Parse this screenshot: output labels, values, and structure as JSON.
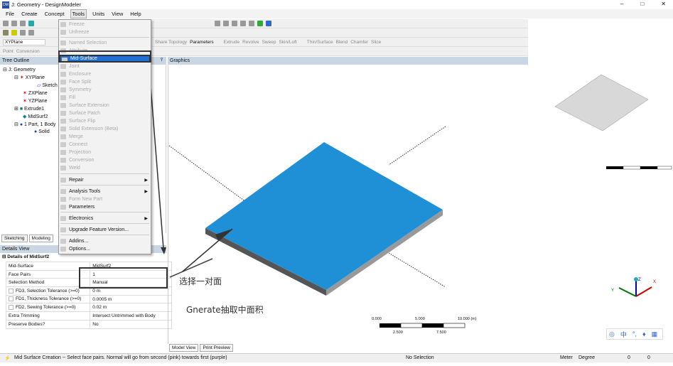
{
  "window": {
    "title": "J: Geometry - DesignModeler",
    "minimize": "–",
    "maximize": "□",
    "close": "✕"
  },
  "menubar": [
    "File",
    "Create",
    "Concept",
    "Tools",
    "Units",
    "View",
    "Help"
  ],
  "toolbar": {
    "plane_select": "XYPlane",
    "point": "Point",
    "conversion": "Conversion",
    "share_topology": "Share Topology",
    "parameters": "Parameters",
    "extrude": "Extrude",
    "revolve": "Revolve",
    "sweep": "Sweep",
    "skin_loft": "Skin/Loft",
    "thin_surface": "Thin/Surface",
    "blend": "Blend",
    "chamfer": "Chamfer",
    "slice": "Slice"
  },
  "tools_menu": [
    {
      "label": "Freeze",
      "enabled": false
    },
    {
      "label": "Unfreeze",
      "enabled": false
    },
    {
      "label": "Named Selection",
      "enabled": false
    },
    {
      "label": "Attribute",
      "enabled": false
    },
    {
      "label": "Mid-Surface",
      "enabled": true,
      "highlighted": true
    },
    {
      "label": "Joint",
      "enabled": false
    },
    {
      "label": "Enclosure",
      "enabled": false
    },
    {
      "label": "Face Split",
      "enabled": false
    },
    {
      "label": "Symmetry",
      "enabled": false
    },
    {
      "label": "Fill",
      "enabled": false
    },
    {
      "label": "Surface Extension",
      "enabled": false
    },
    {
      "label": "Surface Patch",
      "enabled": false
    },
    {
      "label": "Surface Flip",
      "enabled": false
    },
    {
      "label": "Solid Extension (Beta)",
      "enabled": false
    },
    {
      "label": "Merge",
      "enabled": false
    },
    {
      "label": "Connect",
      "enabled": false
    },
    {
      "label": "Projection",
      "enabled": false
    },
    {
      "label": "Conversion",
      "enabled": false
    },
    {
      "label": "Weld",
      "enabled": false
    },
    {
      "label": "Repair",
      "enabled": true,
      "submenu": true
    },
    {
      "label": "Analysis Tools",
      "enabled": true,
      "submenu": true
    },
    {
      "label": "Form New Part",
      "enabled": false
    },
    {
      "label": "Parameters",
      "enabled": true
    },
    {
      "label": "Electronics",
      "enabled": true,
      "submenu": true
    },
    {
      "label": "Upgrade Feature Version...",
      "enabled": true
    },
    {
      "label": "Addins...",
      "enabled": true
    },
    {
      "label": "Options...",
      "enabled": true
    }
  ],
  "tree": {
    "header": "Tree Outline",
    "items": [
      "J: Geometry",
      "XYPlane",
      "Sketch",
      "ZXPlane",
      "YZPlane",
      "Extrude1",
      "MidSurf2",
      "1 Part, 1 Body",
      "Solid"
    ]
  },
  "mode_tabs": [
    "Sketching",
    "Modeling"
  ],
  "details": {
    "header": "Details View",
    "title": "Details of MidSurf2",
    "rows": [
      [
        "Mid-Surface",
        "MidSurf2"
      ],
      [
        "Face Pairs",
        "1"
      ],
      [
        "Selection Method",
        "Manual"
      ],
      [
        "FD3, Selection Tolerance (>=0)",
        "0 m"
      ],
      [
        "FD1, Thickness Tolerance (>=0)",
        "0.0005 m"
      ],
      [
        "FD2, Sewing Tolerance (>=0)",
        "0.02 m"
      ],
      [
        "Extra Trimming",
        "Intersect Untrimmed with Body"
      ],
      [
        "Preserve Bodies?",
        "No"
      ]
    ]
  },
  "graphics": {
    "header": "Graphics",
    "scale_top": [
      "0.000",
      "5.000",
      "10.000 (m)"
    ],
    "scale_bottom": [
      "2.500",
      "7.500"
    ],
    "axes": [
      "X",
      "Y",
      "Z"
    ],
    "tabs": [
      "Model View",
      "Print Preview"
    ]
  },
  "annotations": {
    "select_pair": "选择一对面",
    "generate": "Gnerate抽取中面积"
  },
  "ime": [
    "中",
    "°,"
  ],
  "status": {
    "message": "Mid Surface Creation -- Select face pairs. Normal will go from second (pink) towards first (purple)",
    "selection": "No Selection",
    "length_unit": "Meter",
    "angle_unit": "Degree",
    "v1": "0",
    "v2": "0"
  },
  "colors": {
    "plate": "#1f8fd6",
    "highlight": "#1e6fd6",
    "header": "#c9d6e3"
  }
}
